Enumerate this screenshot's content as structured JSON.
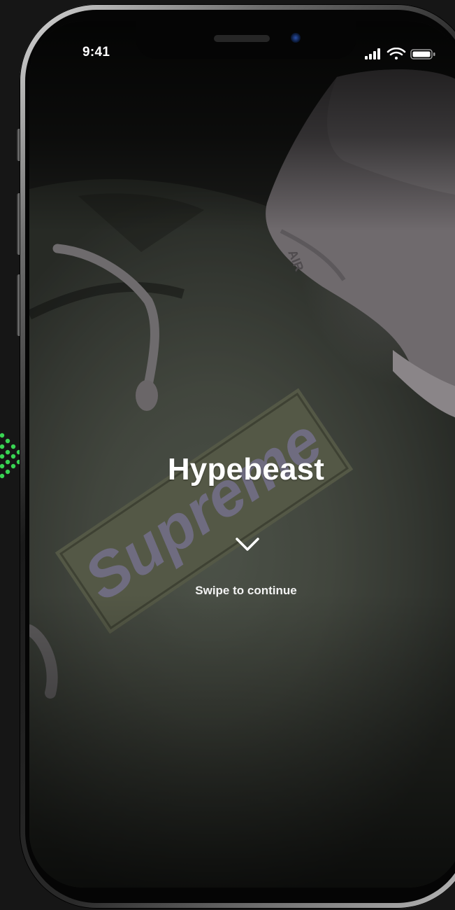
{
  "status_bar": {
    "time": "9:41",
    "icons": [
      "signal-icon",
      "wifi-icon",
      "battery-icon"
    ]
  },
  "hero": {
    "title": "Hypebeast",
    "hint": "Swipe to continue",
    "hint_icon": "chevron-down-icon"
  },
  "background": {
    "box_logo_text": "Supreme",
    "shoe_text": "AIR"
  },
  "colors": {
    "edge_arrow": "#39d353",
    "text": "#ffffff",
    "hoodie": "#3d4039",
    "logo_box": "#545846",
    "logo_letters": "#6f6c80"
  }
}
